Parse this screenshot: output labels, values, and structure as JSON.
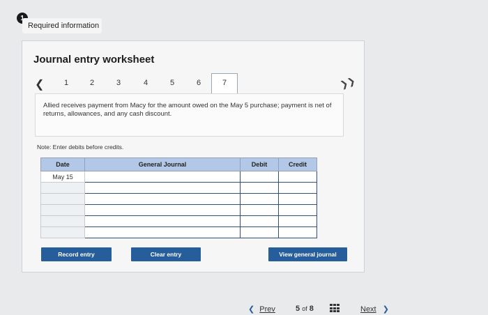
{
  "badge": {
    "icon": "alert-icon",
    "text": "Required information",
    "number": "1"
  },
  "worksheet": {
    "title": "Journal entry worksheet",
    "tabs": [
      "1",
      "2",
      "3",
      "4",
      "5",
      "6",
      "7"
    ],
    "active_tab": "7",
    "description": "Allied receives payment from Macy for the amount owed on the May 5 purchase; payment is net of returns, allowances, and any cash discount.",
    "note": "Note: Enter debits before credits.",
    "table": {
      "headers": {
        "date": "Date",
        "account": "General Journal",
        "debit": "Debit",
        "credit": "Credit"
      },
      "date_value": "May 15"
    },
    "buttons": {
      "record": "Record entry",
      "clear": "Clear entry",
      "view": "View general journal"
    }
  },
  "footer": {
    "prev": "Prev",
    "page_current": "5",
    "page_of": "of",
    "page_total": "8",
    "next": "Next"
  },
  "colors": {
    "button": "#265e9c",
    "table_header": "#b3c8e6"
  }
}
